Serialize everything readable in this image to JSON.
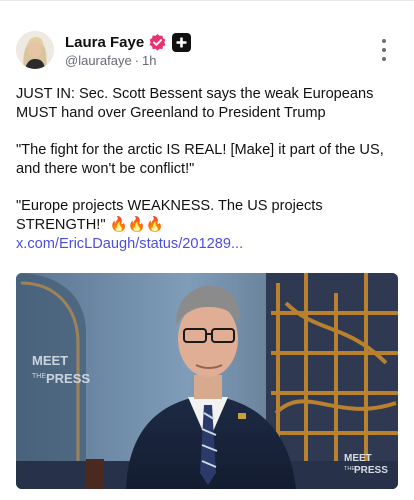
{
  "post": {
    "author": {
      "display_name": "Laura Faye",
      "handle": "@laurafaye",
      "separator": "·",
      "time": "1h",
      "avatar_icon": "user-avatar",
      "verified_color": "#e8336e"
    },
    "paragraphs": [
      "JUST IN: Sec. Scott Bessent says the weak Europeans MUST hand over Greenland to President Trump",
      "\"The fight for the arctic IS REAL! [Make] it part of the US, and there won't be conflict!\"",
      "\"Europe projects WEAKNESS. The US projects STRENGTH!\" 🔥🔥🔥"
    ],
    "link_text": "x.com/EricLDaugh/status/201289...",
    "link_color": "#4d4de0",
    "media": {
      "watermark_left": [
        "MEET",
        "THE",
        "PRESS"
      ],
      "watermark_right": [
        "MEET",
        "THE",
        "PRESS"
      ]
    }
  }
}
